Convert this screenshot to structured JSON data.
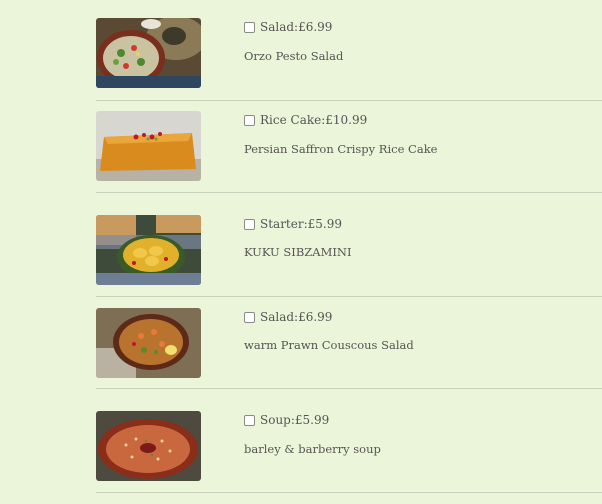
{
  "menu_items": [
    {
      "category": "Salad",
      "price": "£6.99",
      "label": "Salad:£6.99",
      "name": "Orzo Pesto Salad",
      "checked": false,
      "photo": "salad-bowl"
    },
    {
      "category": "Rice Cake",
      "price": "£10.99",
      "label": "Rice Cake:£10.99",
      "name": "Persian Saffron Crispy Rice Cake",
      "checked": false,
      "photo": "rice-cake"
    },
    {
      "category": "Starter",
      "price": "£5.99",
      "label": "Starter:£5.99",
      "name": "KUKU SIBZAMINI",
      "checked": false,
      "photo": "kuku-platter"
    },
    {
      "category": "Salad",
      "price": "£6.99",
      "label": "Salad:£6.99",
      "name": "warm Prawn Couscous Salad",
      "checked": false,
      "photo": "couscous-bowl"
    },
    {
      "category": "Soup",
      "price": "£5.99",
      "label": "Soup:£5.99",
      "name": "barley & barberry soup",
      "checked": false,
      "photo": "soup-plate"
    }
  ],
  "colors": {
    "background": "#ebf5d9",
    "divider": "#c9d1bd",
    "text": "#555555"
  }
}
